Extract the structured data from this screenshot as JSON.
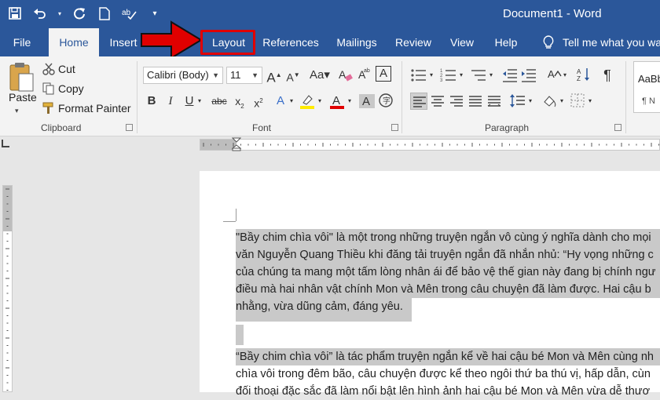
{
  "window": {
    "title": "Document1 - Word"
  },
  "quick_access": {
    "icons": [
      "save-icon",
      "undo-icon",
      "redo-icon",
      "new-document-icon",
      "spelling-icon",
      "customize-icon"
    ]
  },
  "tabs": [
    {
      "label": "File"
    },
    {
      "label": "Home"
    },
    {
      "label": "Insert"
    },
    {
      "label": "Layout"
    },
    {
      "label": "References"
    },
    {
      "label": "Mailings"
    },
    {
      "label": "Review"
    },
    {
      "label": "View"
    },
    {
      "label": "Help"
    },
    {
      "label": "Tell me what you wa"
    }
  ],
  "clipboard": {
    "paste": "Paste",
    "cut": "Cut",
    "copy": "Copy",
    "format_painter": "Format Painter",
    "label": "Clipboard"
  },
  "font": {
    "family": "Calibri (Body)",
    "size": "11",
    "label": "Font"
  },
  "paragraph": {
    "label": "Paragraph"
  },
  "styles": {
    "preview": "AaBb",
    "sub": "¶ N"
  },
  "document": {
    "paragraph1": [
      "\"Bầy chim chìa vôi\" là một trong những truyện ngắn vô cùng ý nghĩa dành cho mọi",
      "văn Nguyễn Quang Thiều khi đăng tải truyện ngắn đã nhắn nhủ: “Hy vọng những c",
      "của chúng ta mang một tấm lòng nhân ái để bảo vệ thế gian này đang bị chính ngư",
      "điều mà hai nhân vật chính Mon và Mên trong câu chuyện đã làm được. Hai cậu b",
      "nhằng, vừa dũng cảm, đáng yêu."
    ],
    "paragraph2": [
      "“Bầy chim chìa vôi” là tác phẩm truyện ngắn kể về hai cậu bé Mon và Mên cùng nh",
      "chìa vôi trong đêm bão, câu chuyện được kể theo ngôi thứ ba thú vị, hấp dẫn, cùn",
      "đối thoại đặc sắc đã làm nổi bật lên hình ảnh hai cậu bé Mon và Mên vừa dễ thươ"
    ]
  },
  "colors": {
    "ribbon_blue": "#2b579a",
    "highlight": "#c9c9c9",
    "callout_red": "#e00000"
  }
}
